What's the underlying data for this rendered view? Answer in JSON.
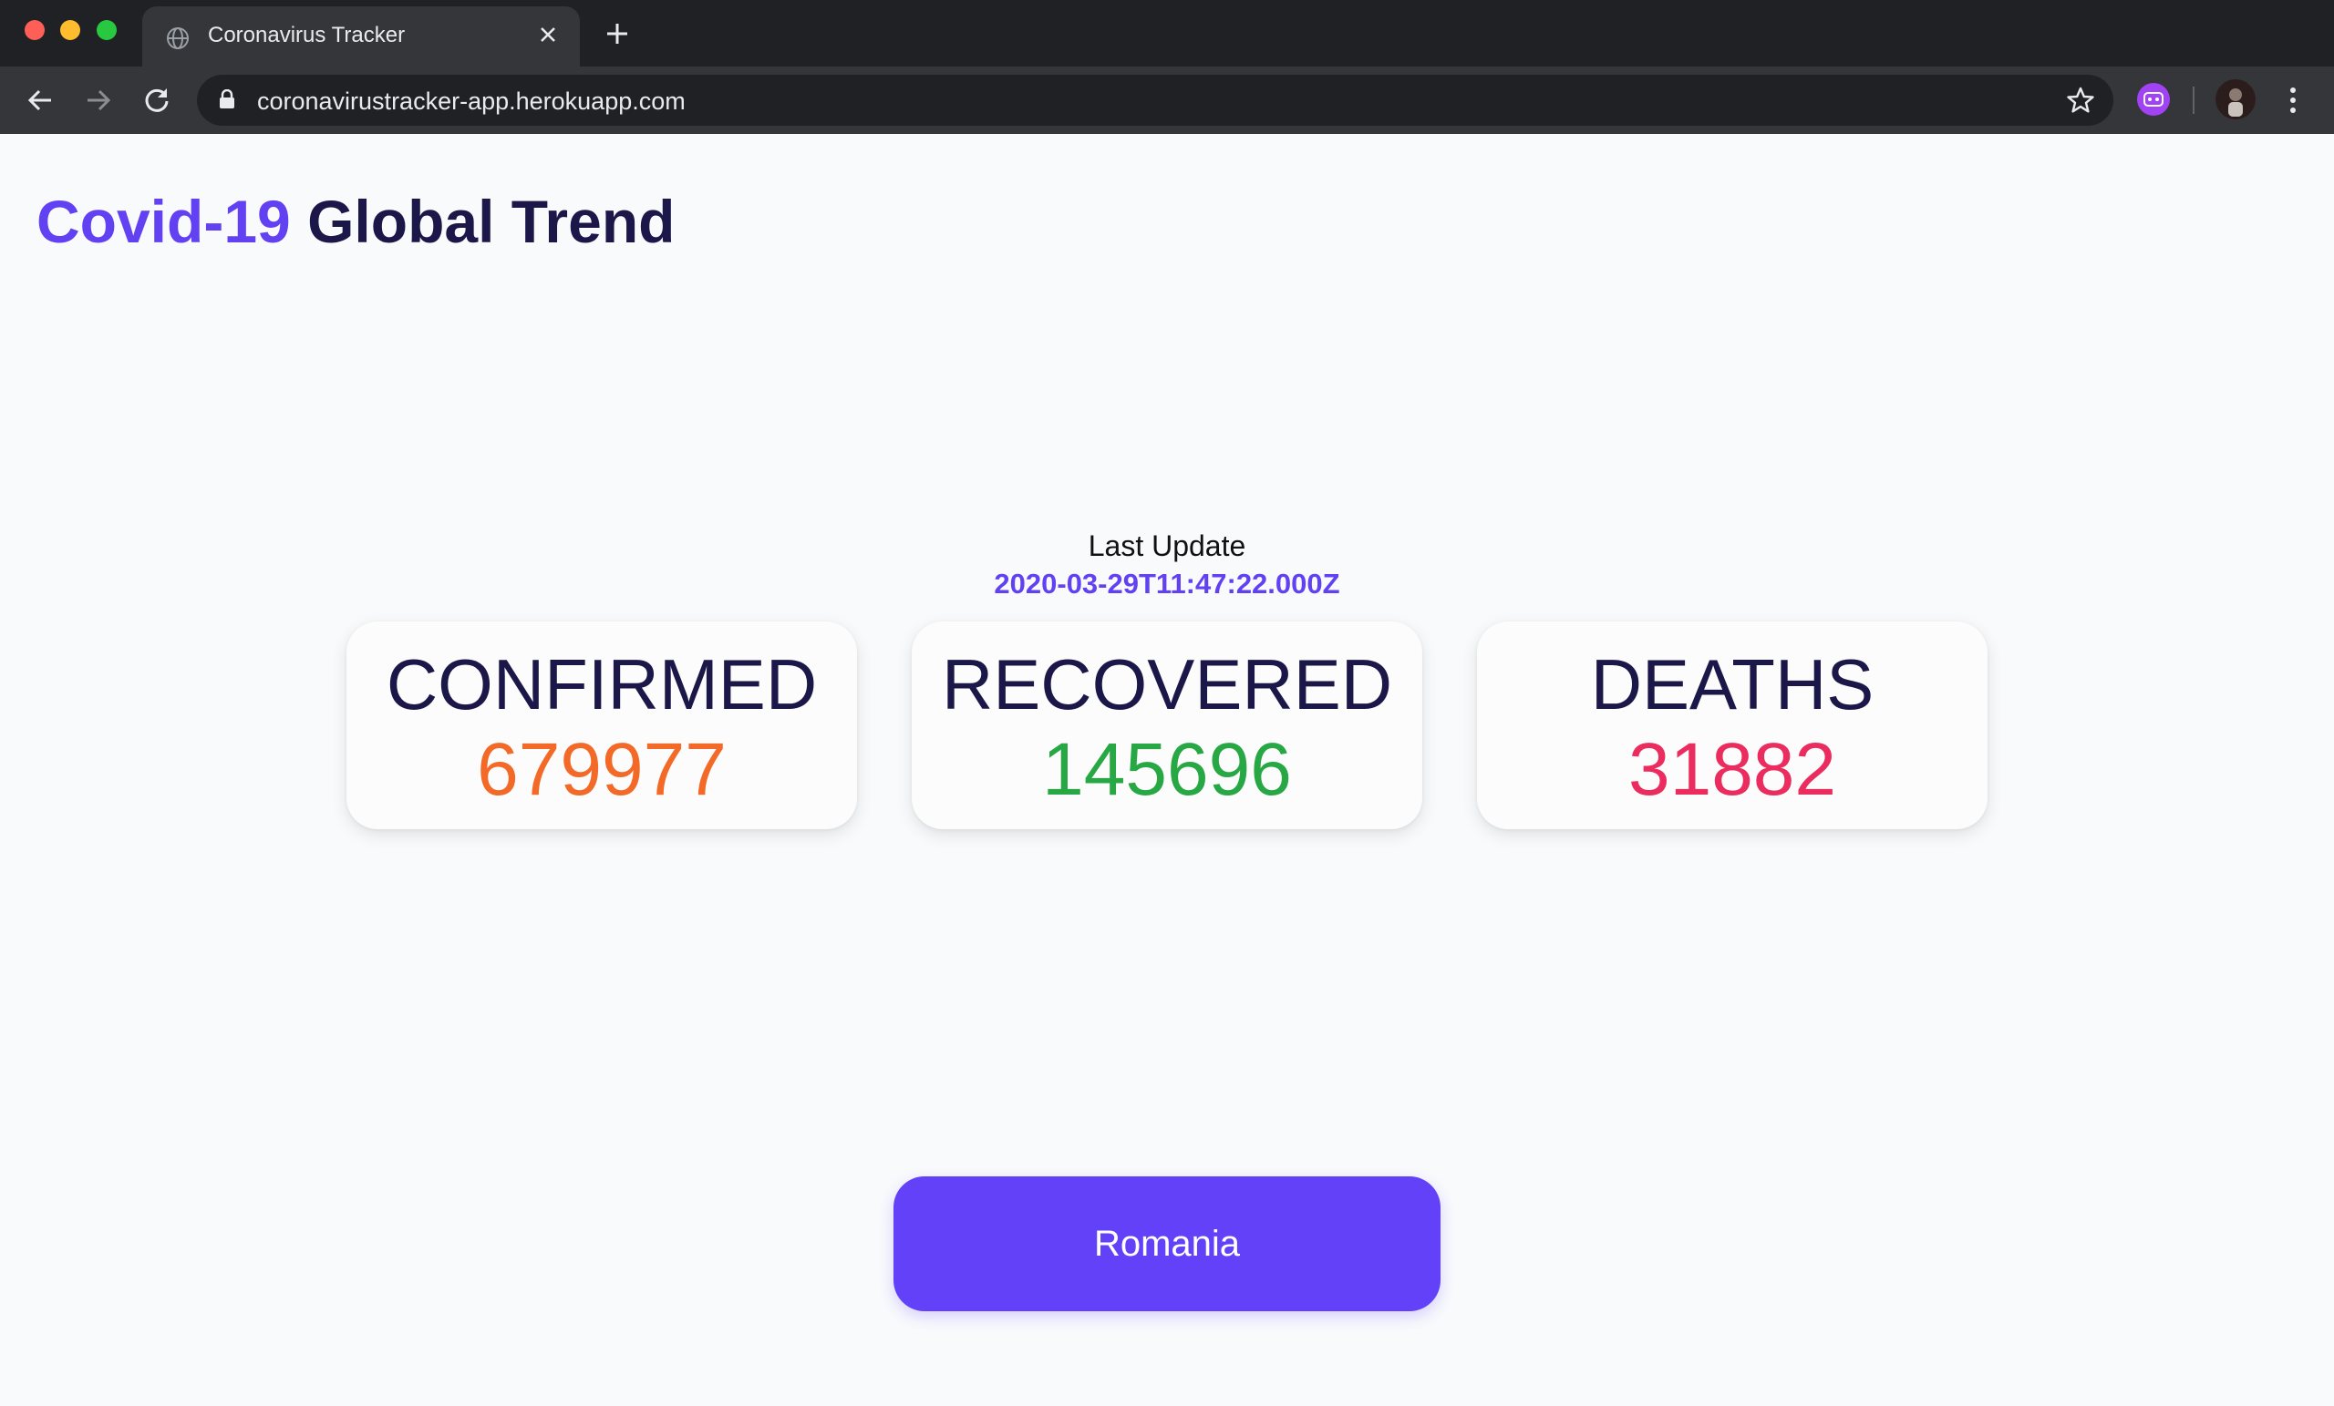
{
  "browser": {
    "tab_title": "Coronavirus Tracker",
    "url": "coronavirustracker-app.herokuapp.com"
  },
  "page": {
    "title_accent": "Covid-19",
    "title_main": "Global Trend",
    "last_update_label": "Last Update",
    "last_update_value": "2020-03-29T11:47:22.000Z"
  },
  "stats": [
    {
      "label": "CONFIRMED",
      "value": "679977"
    },
    {
      "label": "RECOVERED",
      "value": "145696"
    },
    {
      "label": "DEATHS",
      "value": "31882"
    }
  ],
  "country_button": {
    "label": "Romania"
  },
  "colors": {
    "accent": "#6241f2",
    "title_dark": "#1b1748",
    "confirmed": "#f36a28",
    "recovered": "#28a745",
    "deaths": "#ea2d5e",
    "button": "#6241f9"
  },
  "icons": {
    "tab": "globe-icon",
    "close": "close-icon",
    "new_tab": "plus-icon",
    "back": "arrow-left-icon",
    "forward": "arrow-right-icon",
    "reload": "reload-icon",
    "lock": "lock-icon",
    "bookmark": "star-icon",
    "extension": "extension-icon",
    "menu": "kebab-menu-icon"
  }
}
